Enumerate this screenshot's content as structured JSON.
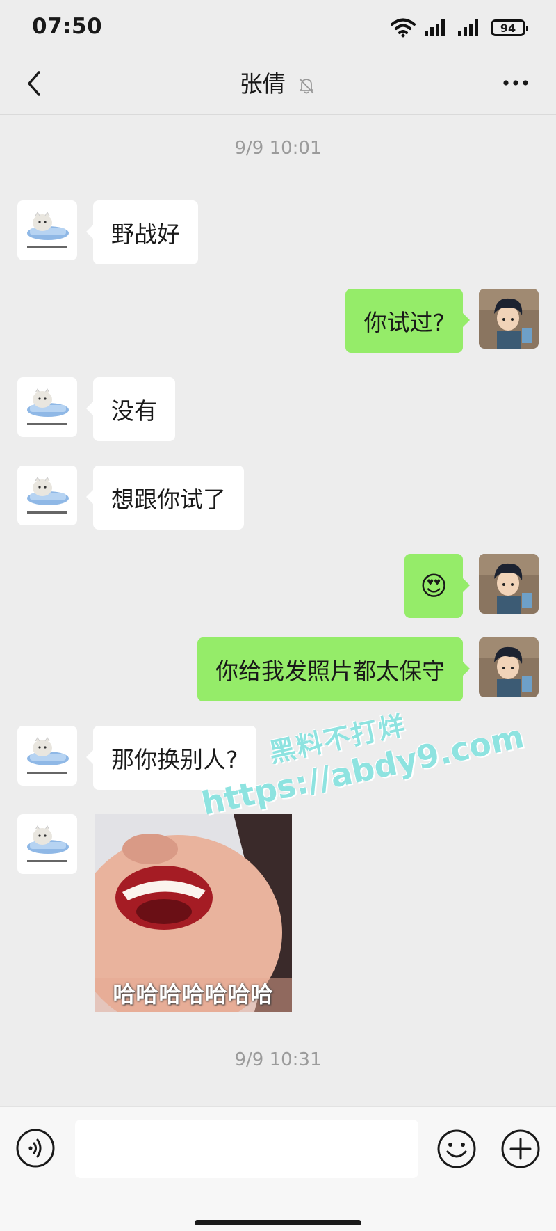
{
  "status_bar": {
    "time": "07:50",
    "battery": "94"
  },
  "header": {
    "title": "张倩"
  },
  "chat": {
    "timestamps": [
      "9/9 10:01",
      "9/9 10:31"
    ],
    "messages": [
      {
        "side": "left",
        "text": "野战好"
      },
      {
        "side": "right",
        "text": "你试过?"
      },
      {
        "side": "left",
        "text": "没有"
      },
      {
        "side": "left",
        "text": "想跟你试了"
      },
      {
        "side": "right",
        "text": "😍"
      },
      {
        "side": "right",
        "text": "你给我发照片都太保守"
      },
      {
        "side": "left",
        "text": "那你换别人?"
      },
      {
        "side": "left",
        "type": "sticker",
        "caption": "哈哈哈哈哈哈哈"
      }
    ]
  },
  "watermark": {
    "line1": "黑料不打烊",
    "line2": "https://abdy9.com"
  },
  "input": {
    "placeholder": ""
  },
  "colors": {
    "background": "#ededed",
    "self_bubble": "#95ec69",
    "other_bubble": "#ffffff"
  }
}
